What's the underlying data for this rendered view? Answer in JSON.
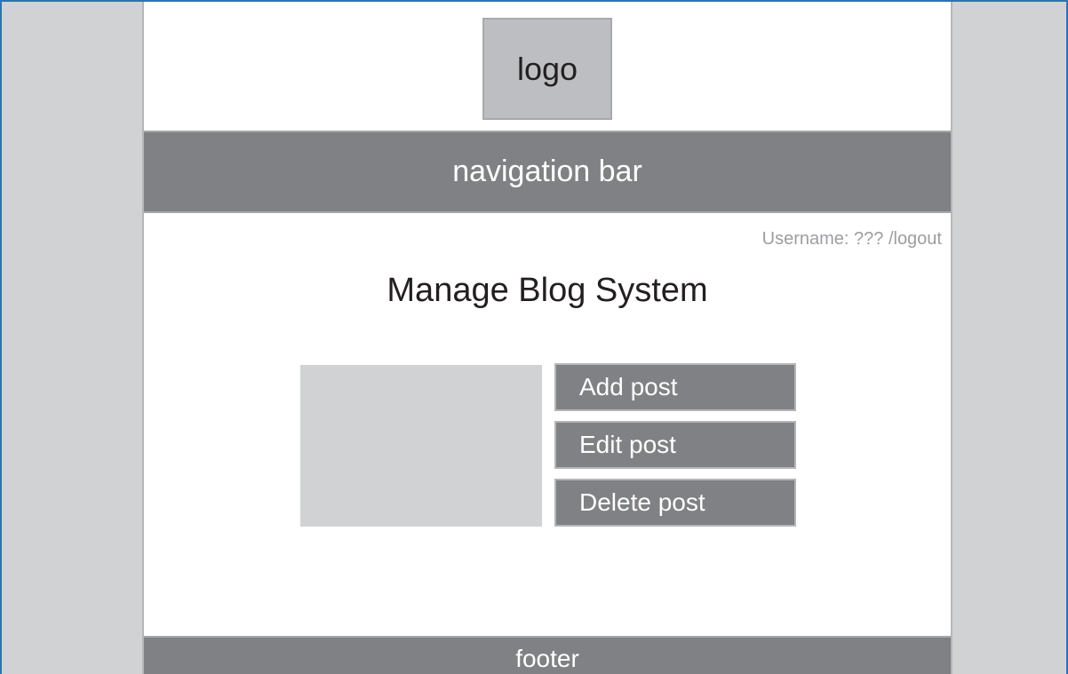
{
  "header": {
    "logo_label": "logo",
    "navigation_label": "navigation bar"
  },
  "user": {
    "username_text": "Username: ??? ",
    "logout_label": "/logout"
  },
  "main": {
    "title": "Manage Blog System",
    "actions": {
      "add_label": "Add post",
      "edit_label": "Edit post",
      "delete_label": "Delete post"
    }
  },
  "footer": {
    "label": "footer"
  },
  "colors": {
    "frame_border": "#2f73b3",
    "side_background": "#d1d2d4",
    "bar_gray": "#808184",
    "logo_gray": "#bdbec1"
  }
}
